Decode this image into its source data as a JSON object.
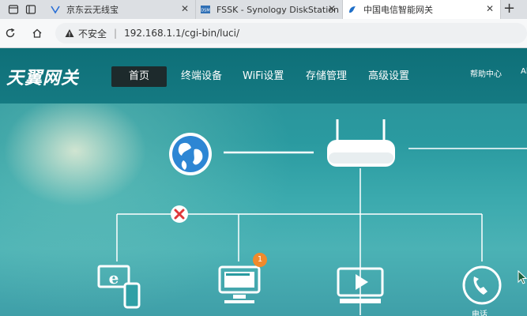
{
  "browser": {
    "tabs": [
      {
        "label": "京东云无线宝",
        "close": "✕"
      },
      {
        "label": "FSSK - Synology DiskStation",
        "close": "✕"
      },
      {
        "label": "中国电信智能网关",
        "close": "✕"
      }
    ],
    "new_tab": "+",
    "address_bar": {
      "security_label": "不安全",
      "separator": "|",
      "url": "192.168.1.1/cgi-bin/luci/"
    }
  },
  "router_ui": {
    "logo": "天翼网关",
    "nav": {
      "home": "首页",
      "terminal": "终端设备",
      "wifi": "WiFi设置",
      "storage": "存储管理",
      "advanced": "高级设置",
      "help": "帮助中心",
      "lang": "Al"
    },
    "topology": {
      "notification_count": "1",
      "connection_status": "disconnected",
      "bottom_label": "电话"
    }
  },
  "colors": {
    "nav_bg": "#0e6f78",
    "active_tab_bg": "#1d2a2c",
    "badge": "#f08a2c",
    "error_mark": "#e0393b"
  }
}
